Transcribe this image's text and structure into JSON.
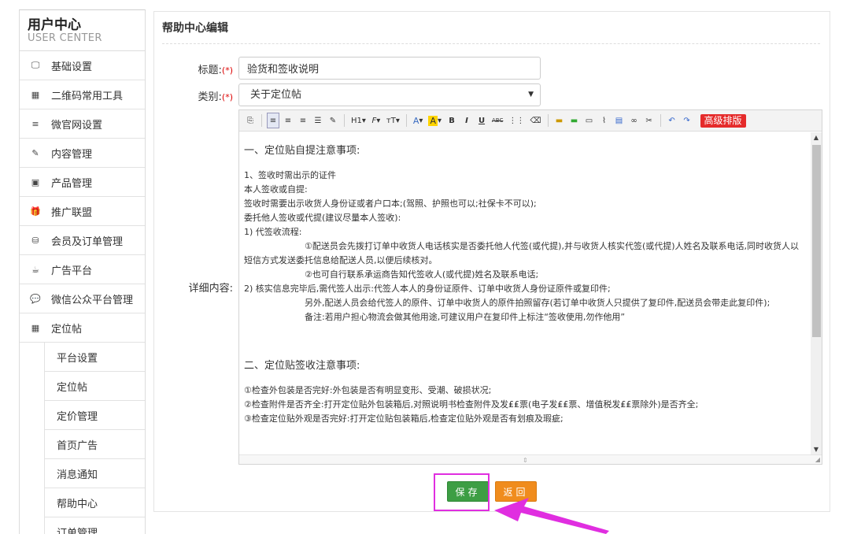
{
  "brand": {
    "title_cn": "用户中心",
    "title_en": "USER CENTER"
  },
  "sidebar": {
    "items": [
      {
        "icon": "monitor-icon",
        "glyph": "🖵",
        "label": "基础设置"
      },
      {
        "icon": "qrcode-icon",
        "glyph": "▦",
        "label": "二维码常用工具"
      },
      {
        "icon": "list-icon",
        "glyph": "≡",
        "label": "微官网设置"
      },
      {
        "icon": "edit-icon",
        "glyph": "✎",
        "label": "内容管理"
      },
      {
        "icon": "image-icon",
        "glyph": "▣",
        "label": "产品管理"
      },
      {
        "icon": "gift-icon",
        "glyph": "🎁",
        "label": "推广联盟"
      },
      {
        "icon": "database-icon",
        "glyph": "⛁",
        "label": "会员及订单管理"
      },
      {
        "icon": "coffee-icon",
        "glyph": "☕",
        "label": "广告平台"
      },
      {
        "icon": "comments-icon",
        "glyph": "💬",
        "label": "微信公众平台管理"
      },
      {
        "icon": "qrcode-icon",
        "glyph": "▦",
        "label": "定位帖"
      }
    ],
    "sub_items": [
      {
        "label": "平台设置"
      },
      {
        "label": "定位帖"
      },
      {
        "label": "定价管理"
      },
      {
        "label": "首页广告"
      },
      {
        "label": "消息通知"
      },
      {
        "label": "帮助中心"
      },
      {
        "label": "订单管理"
      }
    ]
  },
  "panel": {
    "title": "帮助中心编辑"
  },
  "form": {
    "title_label": "标题:",
    "category_label": "类别:",
    "required_mark": "(*)",
    "title_value": "验货和签收说明",
    "category_value": "关于定位帖",
    "content_label": "详细内容:"
  },
  "toolbar": {
    "buttons": [
      "H1",
      "F",
      "тT",
      "A",
      "A",
      "B",
      "I",
      "U",
      "ABC"
    ],
    "advanced_label": "高级排版"
  },
  "content": {
    "h1": "一、定位贴自提注意事项:",
    "p1": "1、签收时需出示的证件",
    "p2": "本人签收或自提:",
    "p3": "签收时需要出示收货人身份证或者户口本;(驾照、护照也可以;社保卡不可以);",
    "p4": "委托他人签收或代提(建议尽量本人签收):",
    "p5": "1) 代签收流程:",
    "p6": "①配送员会先拨打订单中收货人电话核实是否委托他人代签(或代提),并与收货人核实代签(或代提)人姓名及联系电话,同时收货人以短信方式发送委托信息给配送人员,以便后续核对。",
    "p7": "②也可自行联系承运商告知代签收人(或代提)姓名及联系电话;",
    "p8": "2) 核实信息完毕后,需代签人出示:代签人本人的身份证原件、订单中收货人身份证原件或复印件;",
    "p9": "另外,配送人员会给代签人的原件、订单中收货人的原件拍照留存(若订单中收货人只提供了复印件,配送员会带走此复印件);",
    "p10": "备注:若用户担心物流会做其他用途,可建议用户在复印件上标注“签收使用,勿作他用”",
    "h2": "二、定位贴签收注意事项:",
    "p11": "①检查外包装是否完好:外包装是否有明显变形、受潮、破损状况;",
    "p12": "②检查附件是否齐全:打开定位贴外包装箱后,对照说明书检查附件及发₤₤票(电子发₤₤票、增值税发₤₤票除外)是否齐全;",
    "p13": "③检查定位贴外观是否完好:打开定位贴包装箱后,检查定位贴外观是否有划痕及瑕疵;"
  },
  "buttons": {
    "save": "保存",
    "back": "返回"
  },
  "colors": {
    "save": "#3d9e44",
    "back": "#f08c1d",
    "highlight": "#e02ee0",
    "advanced": "#e52b2b"
  }
}
